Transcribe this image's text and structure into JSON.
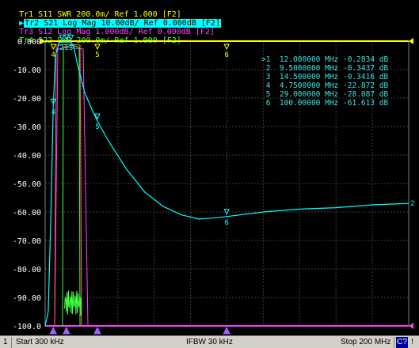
{
  "traces": [
    {
      "id": "Tr1",
      "label": "Tr1 S11 SWR 200.0m/ Ref 1.000 [F2]",
      "color": "#ffff00",
      "active": false
    },
    {
      "id": "Tr2",
      "label": "Tr2 S21 Log Mag 10.00dB/ Ref 0.000dB [F2]",
      "color": "#00ffff",
      "active": true
    },
    {
      "id": "Tr3",
      "label": "Tr3 S12 Log Mag 1.000dB/ Ref 0.000dB [F2]",
      "color": "#ff40ff",
      "active": false
    },
    {
      "id": "Tr4",
      "label": "Tr4 S22 SWR 200.0m/ Ref 1.000 [F2]",
      "color": "#40ff40",
      "active": false
    }
  ],
  "markers": [
    {
      "label": ">1",
      "freq": "12.000000 MHz",
      "value": "-0.2834 dB"
    },
    {
      "label": "2",
      "freq": "9.5000000 MHz",
      "value": "-0.3437 dB"
    },
    {
      "label": "3",
      "freq": "14.500000 MHz",
      "value": "-0.3416 dB"
    },
    {
      "label": "4",
      "freq": "4.7500000 MHz",
      "value": "-22.872 dB"
    },
    {
      "label": "5",
      "freq": "29.000000 MHz",
      "value": "-28.087 dB"
    },
    {
      "label": "6",
      "freq": "100.00000 MHz",
      "value": "-61.613 dB"
    }
  ],
  "chart_data": {
    "type": "line",
    "yticks": [
      "0.000",
      "-10.00",
      "-20.00",
      "-30.00",
      "-40.00",
      "-50.00",
      "-60.00",
      "-70.00",
      "-80.00",
      "-90.00",
      "-100.0"
    ],
    "ylim": [
      -100,
      0
    ],
    "xlim_mhz": [
      0.3,
      200
    ],
    "grid": true,
    "series": [
      {
        "name": "S21",
        "color": "#00ffff",
        "x": [
          0.3,
          2,
          3.5,
          4.75,
          6,
          8,
          9.5,
          12,
          14.5,
          16,
          18,
          22,
          26,
          29,
          35,
          45,
          55,
          65,
          75,
          85,
          95,
          100,
          120,
          140,
          160,
          180,
          200
        ],
        "y": [
          -100,
          -95,
          -60,
          -22.872,
          -5,
          -0.5,
          -0.3437,
          -0.2834,
          -0.3416,
          -2,
          -8,
          -18,
          -24,
          -28.087,
          -35,
          -45,
          -53,
          -58,
          -61,
          -62.5,
          -62,
          -61.613,
          -60,
          -59,
          -58.5,
          -57.5,
          -57
        ]
      }
    ],
    "marker_flags": [
      "1",
      "2",
      "3",
      "4",
      "5",
      "6"
    ],
    "right_label": "2"
  },
  "status": {
    "num": "1",
    "start": "Start 300 kHz",
    "ifbw": "IFBW 30 kHz",
    "stop": "Stop 200 MHz",
    "cal": "C?",
    "arrow": "!"
  }
}
